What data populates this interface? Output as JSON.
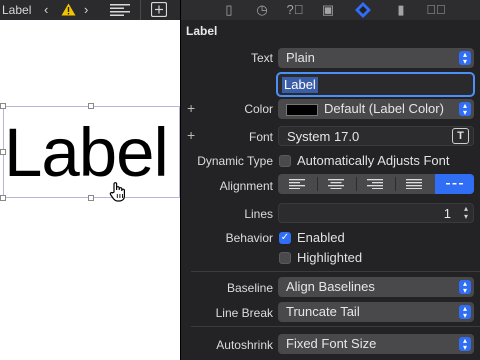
{
  "toolbar": {
    "title": "Label",
    "back_icon": "chevron-left-icon",
    "warning_icon": "warning-icon",
    "forward_icon": "chevron-right-icon",
    "align_icon": "lines-icon",
    "add_icon": "add-editor-icon"
  },
  "canvas": {
    "label_text": "Label"
  },
  "inspector": {
    "section_title": "Label",
    "tabs": [
      "file-icon",
      "history-icon",
      "help-icon",
      "identity-icon",
      "attributes-icon",
      "size-icon",
      "connections-icon"
    ],
    "active_tab": "attributes-icon",
    "accent_color": "#2f6ef5",
    "text": {
      "label": "Text",
      "value": "Plain"
    },
    "text_field": {
      "value": "Label"
    },
    "color": {
      "label": "Color",
      "value": "Default (Label Color)"
    },
    "font": {
      "label": "Font",
      "value": "System 17.0"
    },
    "dynamic_type": {
      "label": "Dynamic Type",
      "checkbox_label": "Automatically Adjusts Font",
      "checked": false
    },
    "alignment": {
      "label": "Alignment",
      "options": [
        "left",
        "center",
        "right",
        "justified",
        "natural"
      ],
      "selected": "natural"
    },
    "lines": {
      "label": "Lines",
      "value": "1"
    },
    "behavior": {
      "label": "Behavior",
      "enabled_label": "Enabled",
      "enabled_checked": true,
      "highlighted_label": "Highlighted",
      "highlighted_checked": false
    },
    "baseline": {
      "label": "Baseline",
      "value": "Align Baselines"
    },
    "line_break": {
      "label": "Line Break",
      "value": "Truncate Tail"
    },
    "autoshrink": {
      "label": "Autoshrink",
      "value": "Fixed Font Size"
    }
  }
}
